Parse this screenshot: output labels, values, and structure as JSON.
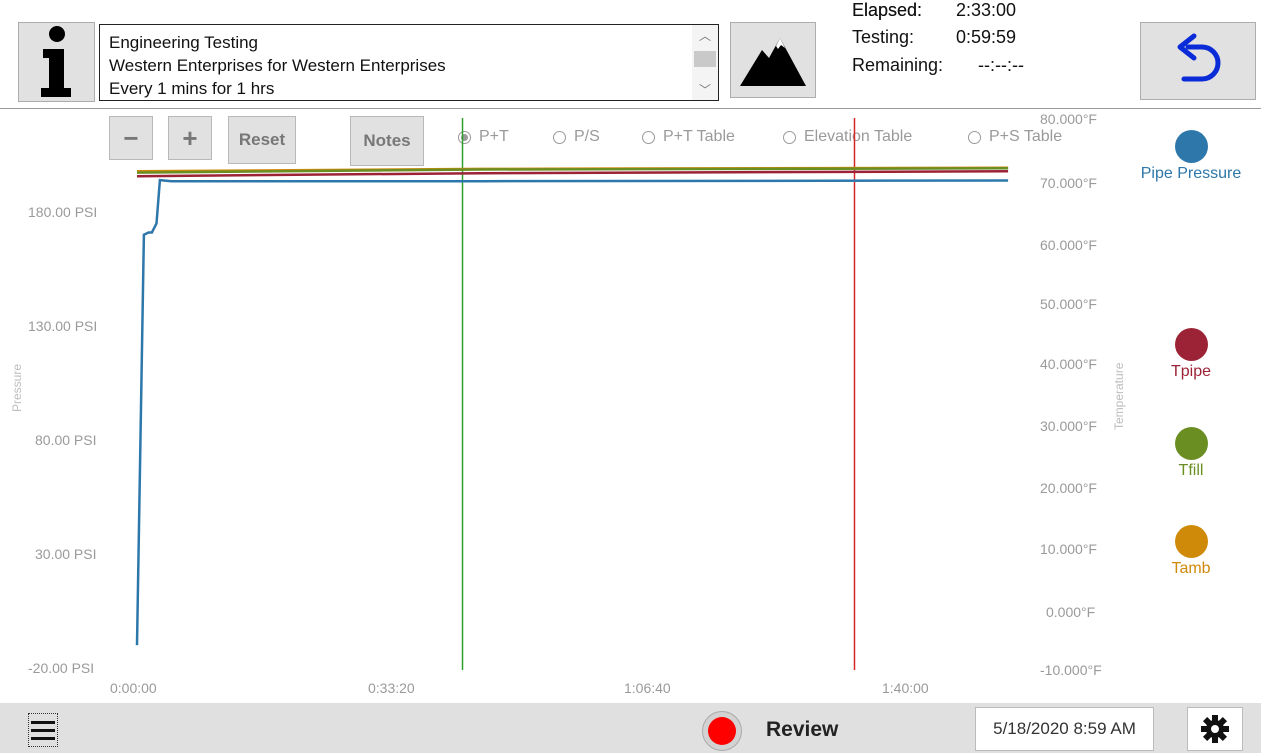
{
  "header": {
    "info_lines": [
      "Engineering Testing",
      "Western Enterprises for Western Enterprises",
      "Every 1 mins for 1 hrs"
    ],
    "elapsed_label": "Elapsed:",
    "elapsed_value": "2:33:00",
    "testing_label": "Testing:",
    "testing_value": "0:59:59",
    "remaining_label": "Remaining:",
    "remaining_value": "--:--:--"
  },
  "toolbar": {
    "zoom_out": "−",
    "zoom_in": "+",
    "reset": "Reset",
    "notes": "Notes"
  },
  "view_options": [
    {
      "label": "P+T",
      "selected": true
    },
    {
      "label": "P/S",
      "selected": false
    },
    {
      "label": "P+T Table",
      "selected": false
    },
    {
      "label": "Elevation Table",
      "selected": false
    },
    {
      "label": "P+S Table",
      "selected": false
    }
  ],
  "chart_data": {
    "type": "line",
    "ylabel": "Pressure",
    "y2label": "Temperature",
    "y_ticks": [
      "180.00 PSI",
      "130.00 PSI",
      "80.00 PSI",
      "30.00 PSI",
      "-20.00 PSI"
    ],
    "y2_ticks": [
      "80.000°F",
      "70.000°F",
      "60.000°F",
      "50.000°F",
      "40.000°F",
      "30.000°F",
      "20.000°F",
      "10.000°F",
      "0.000°F",
      "-10.000°F"
    ],
    "x_ticks": [
      "0:00:00",
      "0:33:20",
      "1:06:40",
      "1:40:00"
    ],
    "ylim": [
      -20,
      200
    ],
    "y2lim": [
      -10,
      80
    ],
    "xlim_seconds": [
      0,
      7800
    ],
    "markers_seconds": [
      2840,
      6260
    ],
    "marker_colors": [
      "#2ca02c",
      "#d62728"
    ],
    "series": [
      {
        "name": "Pipe Pressure",
        "axis": "left",
        "color": "#2e77aa",
        "points": [
          [
            0,
            -10
          ],
          [
            60,
            170
          ],
          [
            100,
            171
          ],
          [
            130,
            171
          ],
          [
            170,
            175
          ],
          [
            200,
            194
          ],
          [
            300,
            193.5
          ],
          [
            3000,
            193.5
          ],
          [
            7600,
            193.8
          ]
        ]
      },
      {
        "name": "Tpipe",
        "axis": "right",
        "color": "#9b2335",
        "points": [
          [
            0,
            70.8
          ],
          [
            3000,
            71.3
          ],
          [
            7600,
            71.6
          ]
        ]
      },
      {
        "name": "Tfill",
        "axis": "right",
        "color": "#6b8e23",
        "points": [
          [
            0,
            71.4
          ],
          [
            3000,
            71.9
          ],
          [
            7600,
            72.1
          ]
        ]
      },
      {
        "name": "Tamb",
        "axis": "right",
        "color": "#d08a0a",
        "points": [
          [
            0,
            71.6
          ],
          [
            3000,
            72.0
          ],
          [
            7600,
            72.2
          ]
        ]
      }
    ]
  },
  "legend": [
    {
      "label": "Pipe Pressure",
      "color": "#2e77aa"
    },
    {
      "label": "Tpipe",
      "color": "#9b2335"
    },
    {
      "label": "Tfill",
      "color": "#6b8e23"
    },
    {
      "label": "Tamb",
      "color": "#d08a0a"
    }
  ],
  "footer": {
    "status": "Review",
    "datetime": "5/18/2020 8:59 AM"
  }
}
